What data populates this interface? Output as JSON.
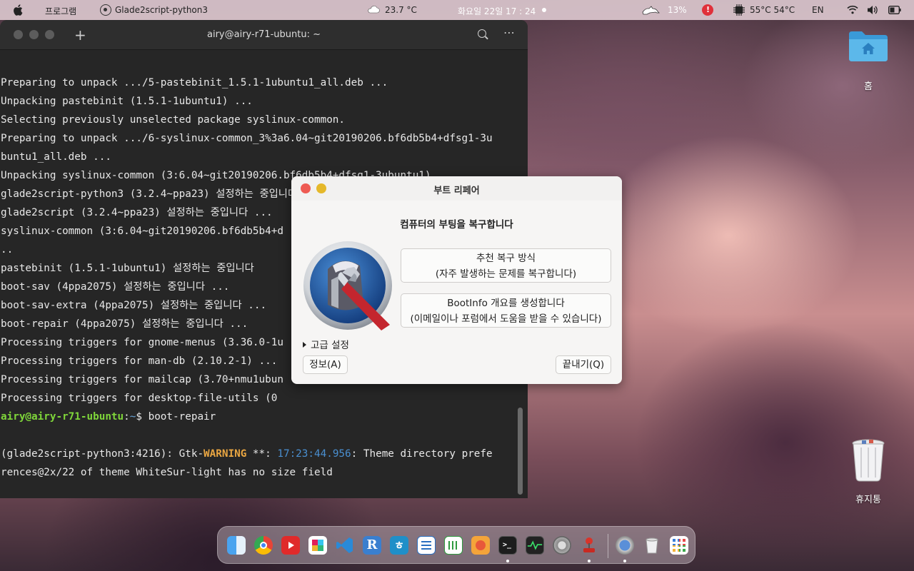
{
  "topbar": {
    "menu_label": "프로그램",
    "active_app": "Glade2script-python3",
    "weather": "23.7 °C",
    "clock": "화요일 22일 17 : 24",
    "battery_percent": "13%",
    "temps": "55°C 54°C",
    "lang": "EN"
  },
  "terminal": {
    "title": "airy@airy-r71-ubuntu: ~",
    "lines": [
      "Preparing to unpack .../5-pastebinit_1.5.1-1ubuntu1_all.deb ...",
      "Unpacking pastebinit (1.5.1-1ubuntu1) ...",
      "Selecting previously unselected package syslinux-common.",
      "Preparing to unpack .../6-syslinux-common_3%3a6.04~git20190206.bf6db5b4+dfsg1-3u",
      "buntu1_all.deb ...",
      "Unpacking syslinux-common (3:6.04~git20190206.bf6db5b4+dfsg1-3ubuntu1) ...",
      "glade2script-python3 (3.2.4~ppa23) 설정하는 중입니다 ...",
      "glade2script (3.2.4~ppa23) 설정하는 중입니다 ...",
      "syslinux-common (3:6.04~git20190206.bf6db5b4+d",
      "..",
      "pastebinit (1.5.1-1ubuntu1) 설정하는 중입니다",
      "boot-sav (4ppa2075) 설정하는 중입니다 ...",
      "boot-sav-extra (4ppa2075) 설정하는 중입니다 ...",
      "boot-repair (4ppa2075) 설정하는 중입니다 ...",
      "Processing triggers for gnome-menus (3.36.0-1u",
      "Processing triggers for man-db (2.10.2-1) ...",
      "Processing triggers for mailcap (3.70+nmu1ubun",
      "Processing triggers for desktop-file-utils (0"
    ],
    "prompt_user": "airy@airy-r71-ubuntu",
    "prompt_sep": ":",
    "prompt_path": "~",
    "prompt_end": "$ ",
    "command": "boot-repair",
    "warn_prefix": "(glade2script-python3:4216): Gtk-",
    "warn_label": "WARNING",
    "warn_mid": " **: ",
    "warn_time": "17:23:44.956",
    "warn_rest": ": Theme directory prefe",
    "warn_line2": "rences@2x/22 of theme WhiteSur-light has no size field"
  },
  "dialog": {
    "title": "부트 리페어",
    "heading": "컴퓨터의 부팅을 복구합니다",
    "recommended_line1": "추천 복구 방식",
    "recommended_line2": "(자주 발생하는 문제를 복구합니다)",
    "bootinfo_line1": "BootInfo 개요를 생성합니다",
    "bootinfo_line2": "(이메일이나 포럼에서 도움을 받을 수 있습니다)",
    "advanced": "고급 설정",
    "about": "정보(A)",
    "quit": "끝내기(Q)"
  },
  "desktop": {
    "home_label": "홈",
    "trash_label": "휴지통"
  },
  "colors": {
    "prompt_green": "#7fd63a",
    "prompt_blue": "#6aa4d8",
    "warning_orange": "#e9a642",
    "close_red": "#ee5a52",
    "minimize_yellow": "#e5b82a"
  },
  "dock": {
    "items": [
      "finder-icon",
      "chrome-icon",
      "youtube-icon",
      "slack-icon",
      "vscode-icon",
      "r-icon",
      "hangul-icon",
      "writer-icon",
      "calc-icon",
      "photos-icon",
      "terminal-icon",
      "system-monitor-icon",
      "settings-icon",
      "joystick-icon",
      "boot-repair-icon",
      "trash-icon",
      "app-grid-icon"
    ]
  }
}
